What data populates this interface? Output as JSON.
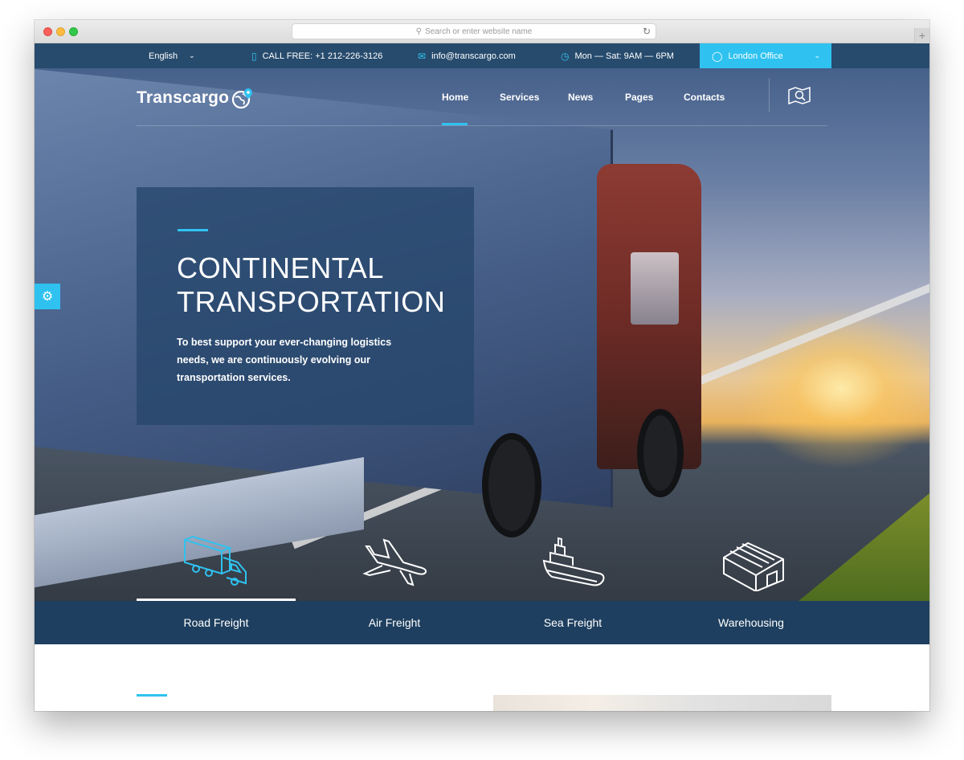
{
  "browser": {
    "url_placeholder": "Search or enter website name"
  },
  "topbar": {
    "language": "English",
    "phone": "CALL FREE: +1 212-226-3126",
    "email": "info@transcargo.com",
    "hours": "Mon — Sat: 9AM — 6PM",
    "office": "London Office"
  },
  "nav": {
    "logo": "Transcargo",
    "items": [
      {
        "label": "Home",
        "active": true
      },
      {
        "label": "Services"
      },
      {
        "label": "News"
      },
      {
        "label": "Pages"
      },
      {
        "label": "Contacts"
      }
    ]
  },
  "hero": {
    "title_line1": "CONTINENTAL",
    "title_line2": "TRANSPORTATION",
    "description": "To best support your ever-changing logistics needs, we are continuously evolving our transportation services."
  },
  "services": [
    {
      "label": "Road Freight",
      "icon": "truck-icon",
      "active": true
    },
    {
      "label": "Air Freight",
      "icon": "airplane-icon"
    },
    {
      "label": "Sea Freight",
      "icon": "ship-icon"
    },
    {
      "label": "Warehousing",
      "icon": "warehouse-icon"
    }
  ],
  "colors": {
    "accent": "#2fc2f0",
    "topbar": "#274b6d",
    "tabs": "#1e3f5f"
  }
}
